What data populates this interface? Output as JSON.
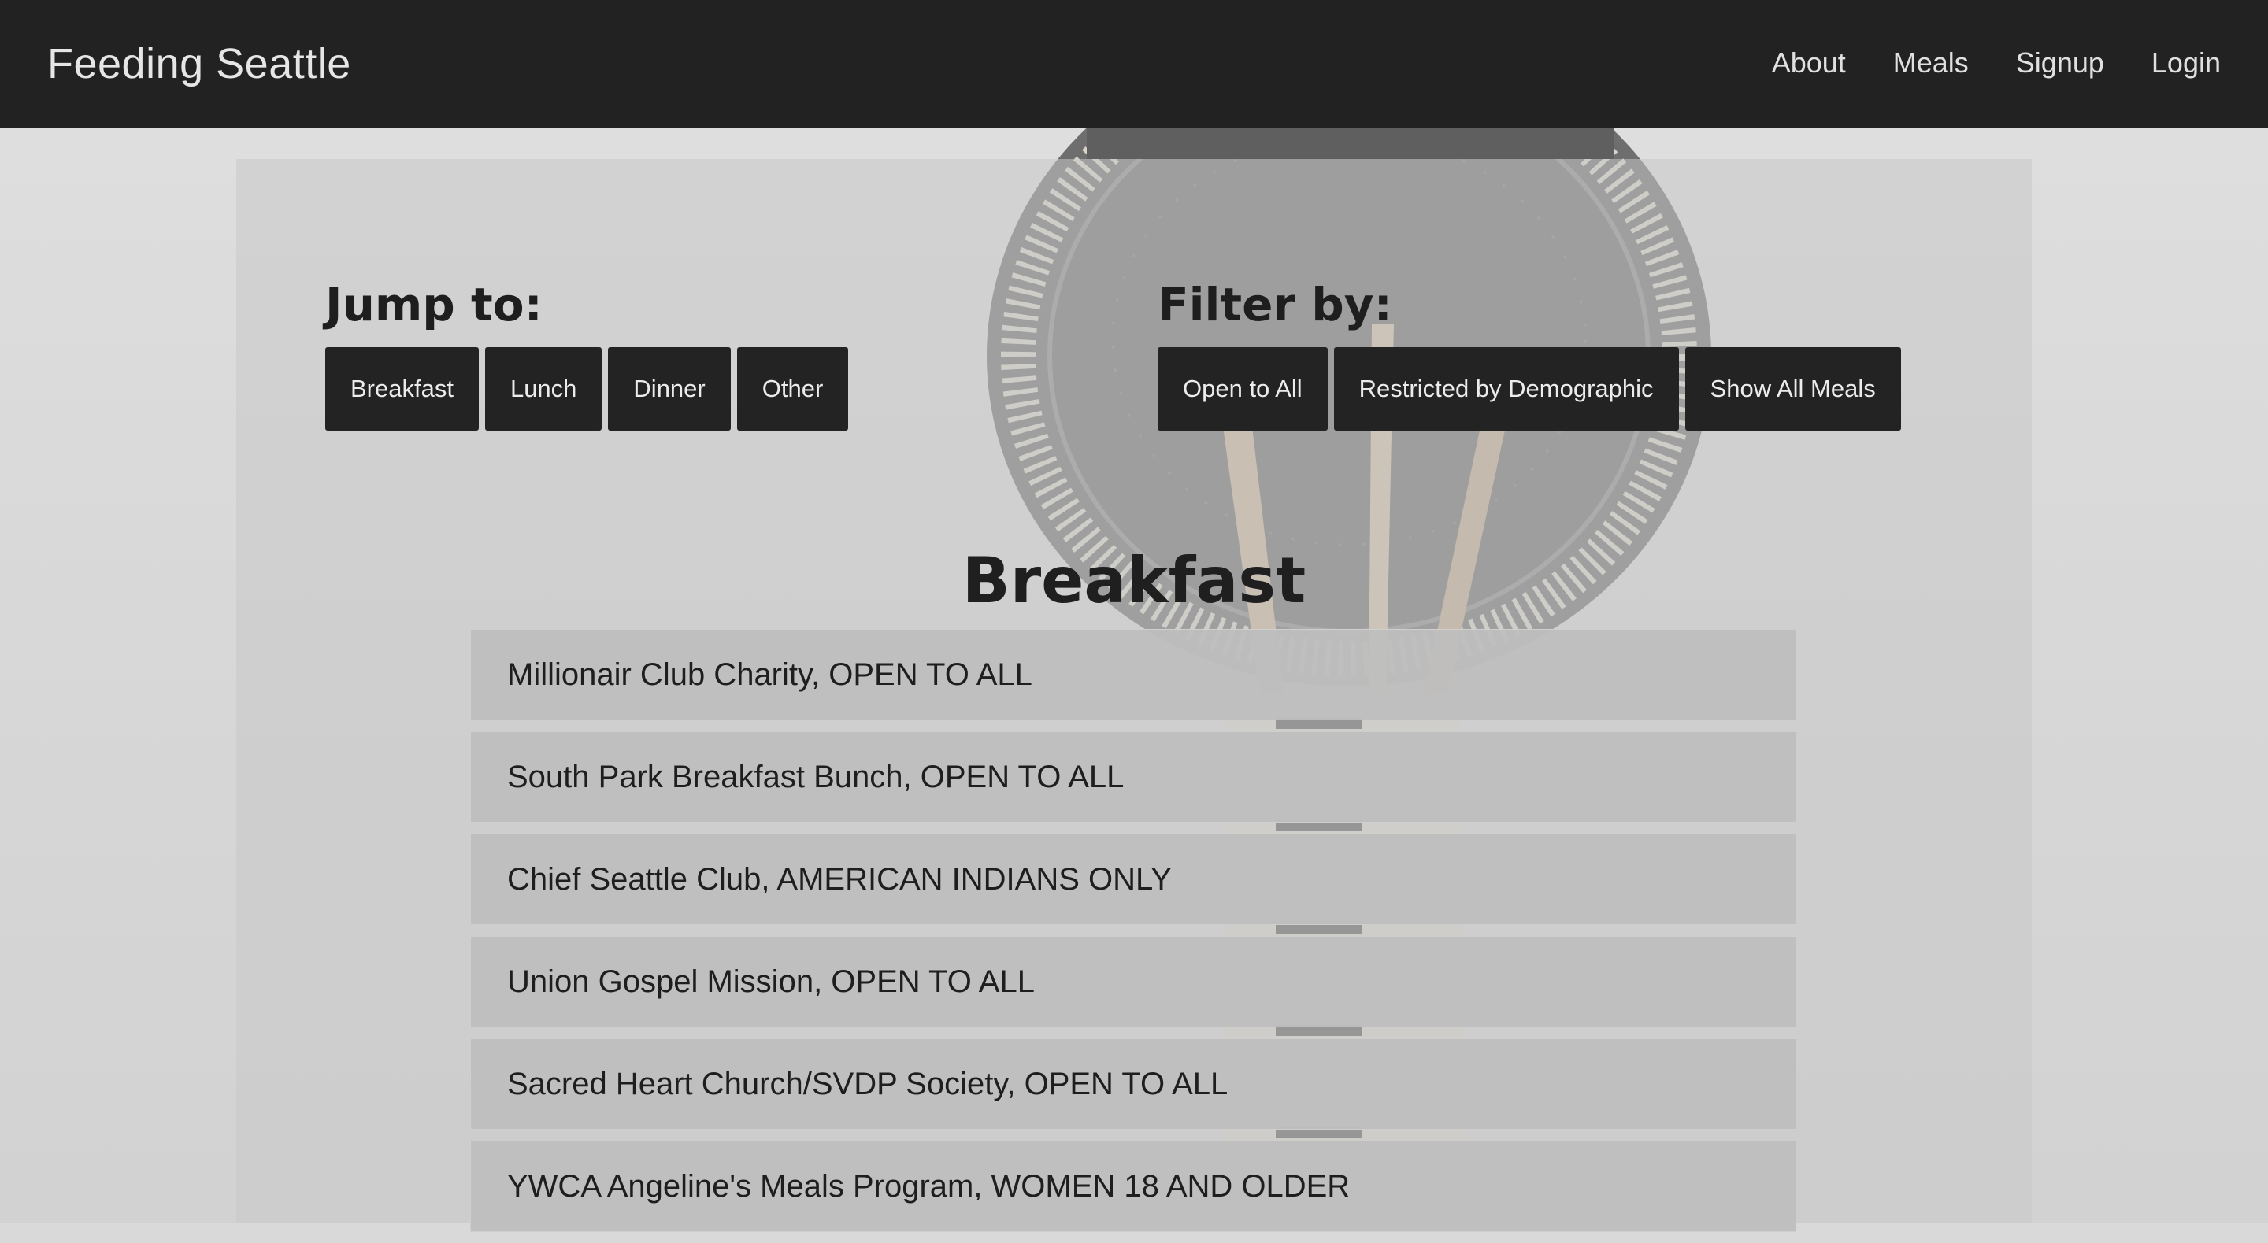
{
  "navbar": {
    "brand": "Feeding Seattle",
    "links": [
      "About",
      "Meals",
      "Signup",
      "Login"
    ]
  },
  "jump": {
    "label": "Jump to:",
    "buttons": [
      "Breakfast",
      "Lunch",
      "Dinner",
      "Other"
    ]
  },
  "filter": {
    "label": "Filter by:",
    "buttons": [
      "Open to All",
      "Restricted by Demographic",
      "Show All Meals"
    ]
  },
  "section": {
    "title": "Breakfast",
    "items": [
      "Millionair Club Charity, OPEN TO ALL",
      "South Park Breakfast Bunch, OPEN TO ALL",
      "Chief Seattle Club, AMERICAN INDIANS ONLY",
      "Union Gospel Mission, OPEN TO ALL",
      "Sacred Heart Church/SVDP Society, OPEN TO ALL",
      "YWCA Angeline's Meals Program, WOMEN 18 AND OLDER"
    ]
  },
  "colors": {
    "navbar": "#222222",
    "button": "#232323",
    "panel": "#c8c8c8",
    "list_item": "#bebebe"
  }
}
